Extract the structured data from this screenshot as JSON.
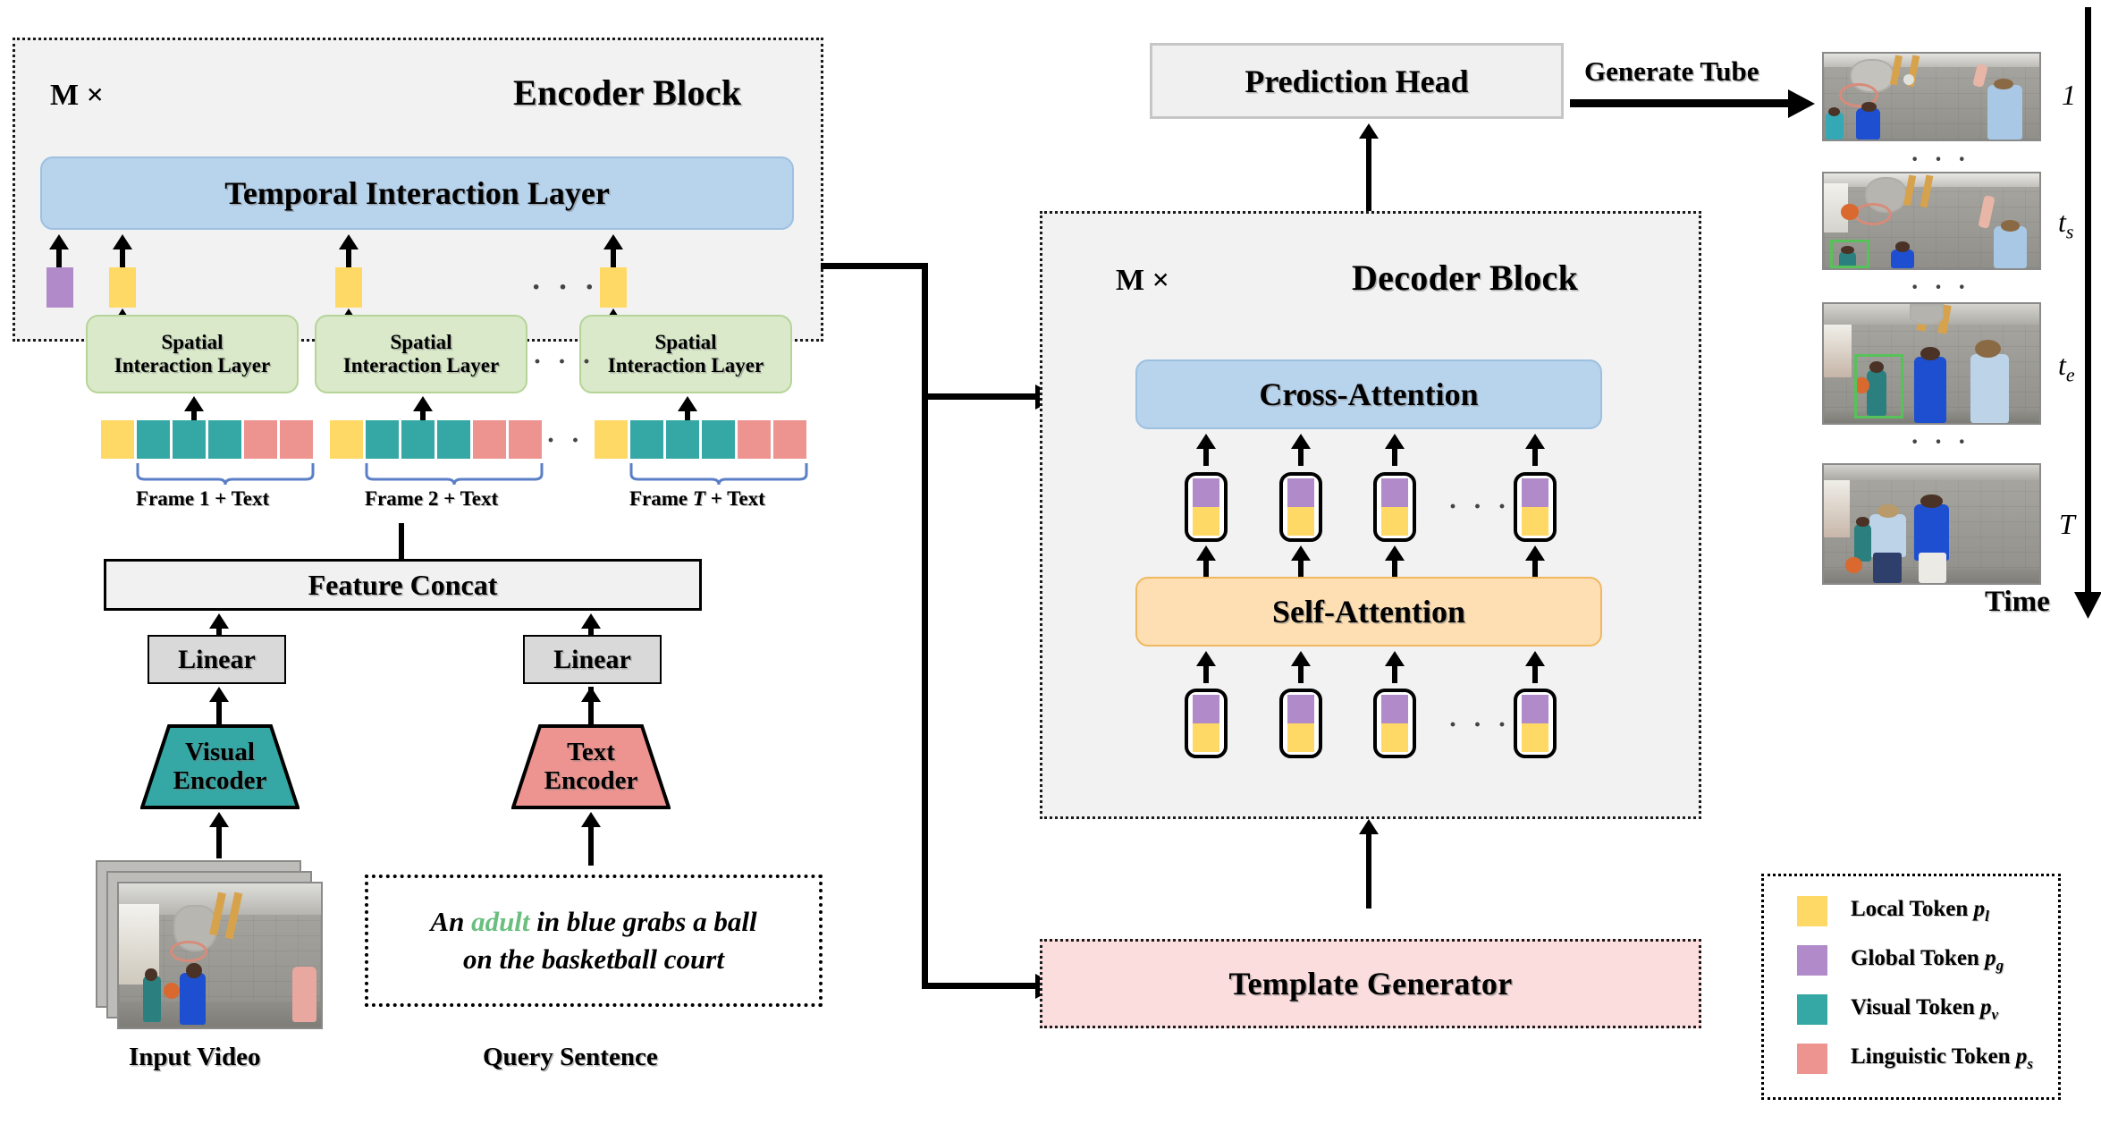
{
  "encoder": {
    "repeat_label": "M ×",
    "title": "Encoder Block",
    "temporal_layer": "Temporal Interaction Layer",
    "spatial_layer_line1": "Spatial",
    "spatial_layer_line2": "Interaction Layer",
    "ellipsis": "· · ·",
    "frame_groups": [
      {
        "label_prefix": "Frame ",
        "label_index": "1",
        "label_suffix": " + Text"
      },
      {
        "label_prefix": "Frame ",
        "label_index": "2",
        "label_suffix": " + Text"
      },
      {
        "label_prefix": "Frame ",
        "label_index": "T",
        "label_suffix": " + Text"
      }
    ],
    "token_row_pattern": [
      "yellow",
      "teal",
      "teal",
      "teal",
      "pink",
      "pink"
    ],
    "top_tokens": [
      "purple",
      "yellow",
      "yellow",
      "yellow"
    ]
  },
  "input_branch": {
    "feature_concat": "Feature Concat",
    "linear_visual": "Linear",
    "linear_text": "Linear",
    "visual_encoder_line1": "Visual",
    "visual_encoder_line2": "Encoder",
    "text_encoder_line1": "Text",
    "text_encoder_line2": "Encoder",
    "input_video_caption": "Input Video",
    "query_caption": "Query Sentence",
    "query_sentence": {
      "part1": "An ",
      "highlight": "adult",
      "part2": " in blue grabs a ball",
      "line2": "on the basketball court"
    }
  },
  "decoder": {
    "repeat_label": "M ×",
    "title": "Decoder Block",
    "cross_attention": "Cross-Attention",
    "self_attention": "Self-Attention",
    "ellipsis": "· · ·",
    "capsule_count_visible": 4
  },
  "prediction": {
    "head_label": "Prediction Head",
    "generate_tube_label": "Generate Tube"
  },
  "template_generator": {
    "label": "Template Generator"
  },
  "timeline": {
    "frames": [
      {
        "time_label": "1",
        "time_sub": "",
        "has_bbox": false
      },
      {
        "time_label": "t",
        "time_sub": "s",
        "has_bbox": true
      },
      {
        "time_label": "t",
        "time_sub": "e",
        "has_bbox": true
      },
      {
        "time_label": "T",
        "time_sub": "",
        "has_bbox": false
      }
    ],
    "separator": "· · ·",
    "axis_label": "Time"
  },
  "legend": {
    "items": [
      {
        "color_name": "yellow",
        "color": "#FFD966",
        "label": "Local Token ",
        "symbol": "p",
        "symbol_sub": "l"
      },
      {
        "color_name": "purple",
        "color": "#B18BC9",
        "label": "Global Token ",
        "symbol": "p",
        "symbol_sub": "g"
      },
      {
        "color_name": "teal",
        "color": "#35A8A5",
        "label": "Visual Token ",
        "symbol": "p",
        "symbol_sub": "v"
      },
      {
        "color_name": "pink",
        "color": "#EE9490",
        "label": "Linguistic Token ",
        "symbol": "p",
        "symbol_sub": "s"
      }
    ]
  },
  "colors": {
    "yellow": "#FFD966",
    "purple": "#B18BC9",
    "teal": "#35A8A5",
    "pink": "#EE9490",
    "blue_layer": "#B8D3EC",
    "green_layer": "#D9E9C9",
    "orange_layer": "#FDDFB3",
    "panel_grey": "#F2F2F2",
    "template_pink": "#FBDDDE",
    "highlight_green": "#6ABF7F",
    "bbox_green": "#57C25A"
  }
}
